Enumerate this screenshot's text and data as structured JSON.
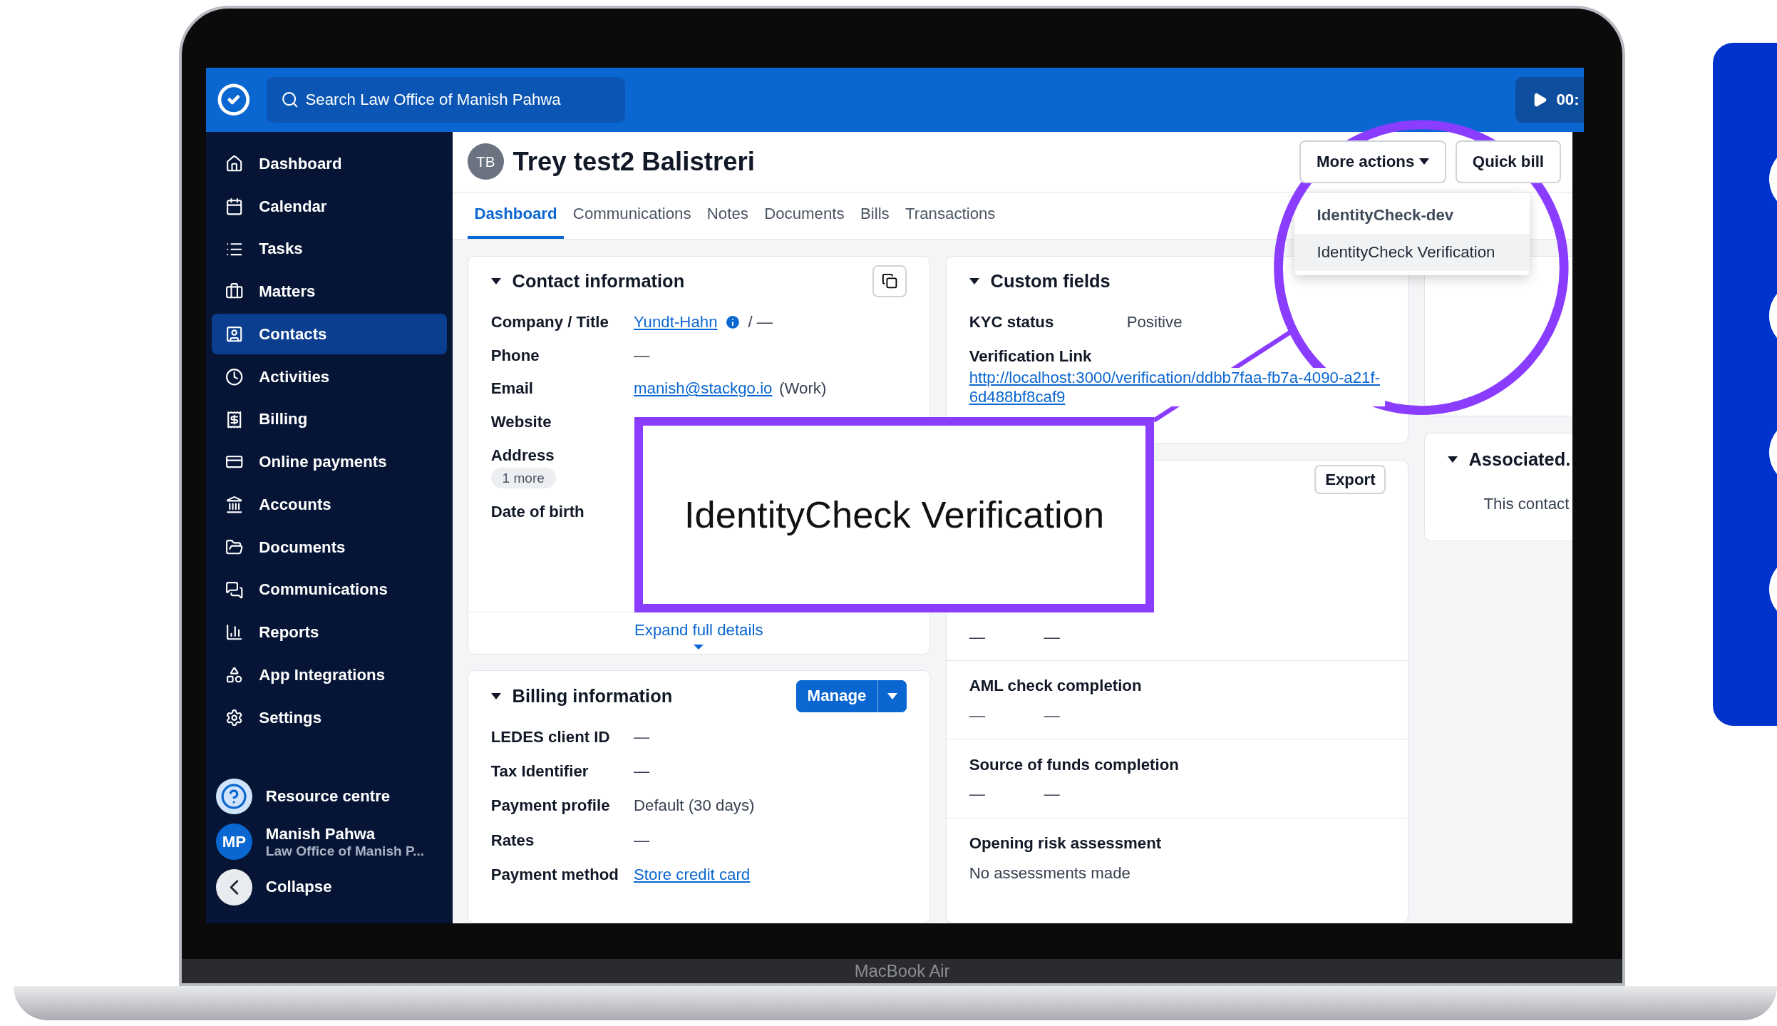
{
  "app_bar": {
    "search": {
      "placeholder": "Search Law Office of Manish Pahwa"
    },
    "timer": "00:"
  },
  "sidebar": {
    "items": [
      {
        "label": "Dashboard",
        "selected": false
      },
      {
        "label": "Calendar",
        "selected": false
      },
      {
        "label": "Tasks",
        "selected": false
      },
      {
        "label": "Matters",
        "selected": false
      },
      {
        "label": "Contacts",
        "selected": true
      },
      {
        "label": "Activities",
        "selected": false
      },
      {
        "label": "Billing",
        "selected": false
      },
      {
        "label": "Online payments",
        "selected": false
      },
      {
        "label": "Accounts",
        "selected": false
      },
      {
        "label": "Documents",
        "selected": false
      },
      {
        "label": "Communications",
        "selected": false
      },
      {
        "label": "Reports",
        "selected": false
      },
      {
        "label": "App Integrations",
        "selected": false
      },
      {
        "label": "Settings",
        "selected": false
      }
    ],
    "resource_centre": "Resource centre",
    "user": {
      "initials": "MP",
      "name": "Manish Pahwa",
      "org": "Law Office of Manish P..."
    },
    "collapse": "Collapse"
  },
  "contact": {
    "initials": "TB",
    "name": "Trey test2 Balistreri",
    "actions": [
      "More actions",
      "Quick bill"
    ]
  },
  "actions_menu": {
    "items": [
      {
        "label": "IdentityCheck-dev",
        "kind": "group",
        "selected": false
      },
      {
        "label": "IdentityCheck Verification",
        "kind": "option",
        "selected": true
      }
    ]
  },
  "tabs": [
    {
      "label": "Dashboard",
      "selected": true
    },
    {
      "label": "Communications",
      "selected": false
    },
    {
      "label": "Notes",
      "selected": false
    },
    {
      "label": "Documents",
      "selected": false
    },
    {
      "label": "Bills",
      "selected": false
    },
    {
      "label": "Transactions",
      "selected": false
    }
  ],
  "contact_information": {
    "title": "Contact information",
    "rows": [
      {
        "label": "Company / Title",
        "link": "Yundt-Hahn",
        "info": true,
        "value": "/ —"
      },
      {
        "label": "Phone",
        "value": "—"
      },
      {
        "label": "Email",
        "link": "manish@stackgo.io",
        "value": "(Work)"
      },
      {
        "label": "Website"
      },
      {
        "label": "Address",
        "chip": "1 more"
      },
      {
        "label": "Date of birth"
      }
    ],
    "expand": "Expand full details"
  },
  "billing_information": {
    "title": "Billing information",
    "button": "Manage",
    "rows": [
      {
        "label": "LEDES client ID",
        "value": "—"
      },
      {
        "label": "Tax Identifier",
        "value": "—"
      },
      {
        "label": "Payment profile",
        "value": "Default (30 days)"
      },
      {
        "label": "Rates",
        "value": "—"
      },
      {
        "label": "Payment method",
        "link": "Store credit card"
      }
    ]
  },
  "custom_fields": {
    "title": "Custom fields",
    "rows": [
      {
        "label": "KYC status",
        "value": "Positive",
        "kind": "inline"
      },
      {
        "label": "Verification Link",
        "link": "http://localhost:3000/verification/ddbb7faa-fb7a-4090-a21f-6d488bf8caf9",
        "kind": "stacked"
      }
    ]
  },
  "checks": {
    "button": "Export",
    "sections": [
      {
        "values": [
          "—",
          "—"
        ]
      },
      {
        "title": "AML check completion",
        "values": [
          "—",
          "—"
        ]
      },
      {
        "title": "Source of funds completion",
        "values": [
          "—",
          "—"
        ]
      },
      {
        "title": "Opening risk assessment",
        "note": "No assessments made"
      }
    ]
  },
  "associated": {
    "title": "Associated.",
    "text": "This contact"
  },
  "callout": {
    "text": "IdentityCheck Verification"
  },
  "device": {
    "label": "MacBook Air"
  }
}
